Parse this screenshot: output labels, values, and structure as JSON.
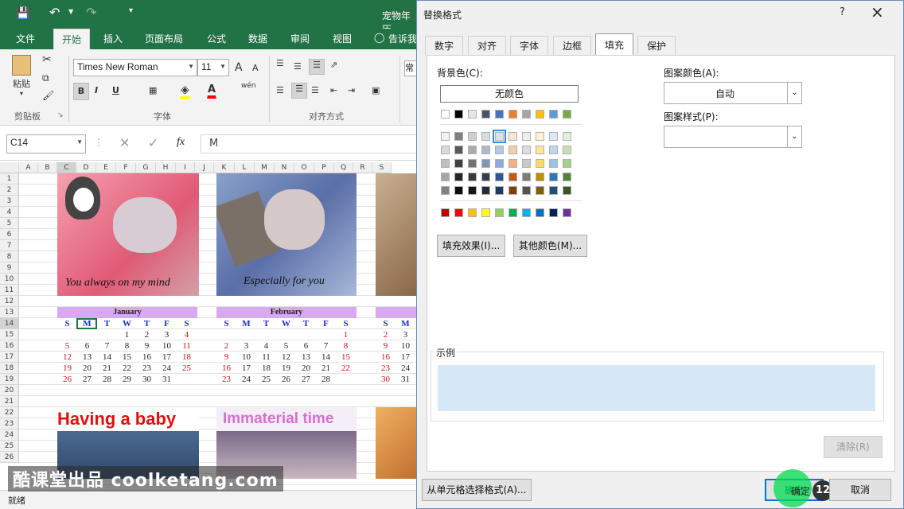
{
  "excel": {
    "doc_title": "宠物年历",
    "tabs": [
      "文件",
      "开始",
      "插入",
      "页面布局",
      "公式",
      "数据",
      "审阅",
      "视图"
    ],
    "tell_me": "告诉我",
    "clipboard": {
      "paste": "粘贴",
      "group": "剪贴板"
    },
    "font": {
      "name": "Times New Roman",
      "size": "11",
      "group": "字体",
      "grow": "A",
      "shrink": "A",
      "bold": "B",
      "italic": "I",
      "underline": "U",
      "wen": "wén"
    },
    "align": {
      "group": "对齐方式"
    },
    "style_peek": "常",
    "name_box": "C14",
    "fx": "fx",
    "formula_value": "M",
    "columns": [
      "A",
      "B",
      "C",
      "D",
      "E",
      "F",
      "G",
      "H",
      "I",
      "J",
      "K",
      "L",
      "M",
      "N",
      "O",
      "P",
      "Q",
      "R",
      "S"
    ],
    "rows": [
      "1",
      "2",
      "3",
      "4",
      "5",
      "6",
      "7",
      "8",
      "9",
      "10",
      "11",
      "12",
      "13",
      "14",
      "15",
      "16",
      "17",
      "18",
      "19",
      "20",
      "21",
      "22",
      "23",
      "24",
      "25",
      "26"
    ],
    "pictures": [
      "You always on my mind",
      "Especially for you",
      "Having a baby",
      "Immaterial time"
    ],
    "calendars": [
      {
        "month": "January",
        "days": [
          "S",
          "M",
          "T",
          "W",
          "T",
          "F",
          "S"
        ],
        "weeks": [
          [
            "",
            "",
            "",
            "",
            "1",
            "2",
            "3",
            "4"
          ],
          [
            "5",
            "6",
            "7",
            "8",
            "9",
            "10",
            "11"
          ],
          [
            "12",
            "13",
            "14",
            "15",
            "16",
            "17",
            "18"
          ],
          [
            "19",
            "20",
            "21",
            "22",
            "23",
            "24",
            "25"
          ],
          [
            "26",
            "27",
            "28",
            "29",
            "30",
            "31",
            ""
          ]
        ]
      },
      {
        "month": "February",
        "days": [
          "S",
          "M",
          "T",
          "W",
          "T",
          "F",
          "S"
        ],
        "weeks": [
          [
            "",
            "",
            "",
            "",
            "",
            "",
            "1"
          ],
          [
            "2",
            "3",
            "4",
            "5",
            "6",
            "7",
            "8"
          ],
          [
            "9",
            "10",
            "11",
            "12",
            "13",
            "14",
            "15"
          ],
          [
            "16",
            "17",
            "18",
            "19",
            "20",
            "21",
            "22"
          ],
          [
            "23",
            "24",
            "25",
            "26",
            "27",
            "28",
            ""
          ]
        ]
      }
    ],
    "cal3_days": [
      "S",
      "M"
    ],
    "cal3_nums": [
      [
        "",
        ""
      ],
      [
        "2",
        "3"
      ],
      [
        "9",
        "10"
      ],
      [
        "16",
        "17"
      ],
      [
        "23",
        "24"
      ],
      [
        "30",
        "31"
      ]
    ],
    "status": "就绪"
  },
  "dialog": {
    "title": "替换格式",
    "help": "?",
    "close": "×",
    "tabs": [
      "数字",
      "对齐",
      "字体",
      "边框",
      "填充",
      "保护"
    ],
    "active_tab": "填充",
    "bg_color_label": "背景色(C):",
    "no_color": "无颜色",
    "fill_effects": "填充效果(I)...",
    "more_colors": "其他颜色(M)...",
    "pattern_color_label": "图案颜色(A):",
    "pattern_color_value": "自动",
    "pattern_style_label": "图案样式(P):",
    "pattern_style_value": "",
    "sample_label": "示例",
    "sample_color": "#d7e8f7",
    "clear": "清除(R)",
    "from_cell": "从单元格选择格式(A)...",
    "ok": "确定",
    "cancel": "取消",
    "step_badge": "12",
    "theme_top": [
      "#ffffff",
      "#000000",
      "#e7e6e6",
      "#44546a",
      "#4472c4",
      "#ed7d31",
      "#a5a5a5",
      "#ffc000",
      "#5b9bd5",
      "#70ad47"
    ],
    "theme_shades": [
      [
        "#f2f2f2",
        "#7f7f7f",
        "#d0cece",
        "#d6dce4",
        "#d9e1f2",
        "#fce4d6",
        "#ededed",
        "#fff2cc",
        "#ddebf7",
        "#e2efda"
      ],
      [
        "#d9d9d9",
        "#595959",
        "#aeaaaa",
        "#acb9ca",
        "#b4c6e7",
        "#f8cbad",
        "#dbdbdb",
        "#ffe699",
        "#bdd7ee",
        "#c6e0b4"
      ],
      [
        "#bfbfbf",
        "#404040",
        "#757171",
        "#8497b0",
        "#8ea9db",
        "#f4b084",
        "#c9c9c9",
        "#ffd966",
        "#9bc2e6",
        "#a9d08e"
      ],
      [
        "#a6a6a6",
        "#262626",
        "#3a3838",
        "#333f4f",
        "#2f5597",
        "#c65911",
        "#7b7b7b",
        "#bf8f00",
        "#2e75b6",
        "#548235"
      ],
      [
        "#808080",
        "#0d0d0d",
        "#161616",
        "#222b35",
        "#1f3864",
        "#833c0c",
        "#525252",
        "#7f6000",
        "#1f4e78",
        "#375623"
      ]
    ],
    "standard": [
      "#c00000",
      "#ff0000",
      "#ffc000",
      "#ffff00",
      "#92d050",
      "#00b050",
      "#00b0f0",
      "#0070c0",
      "#002060",
      "#7030a0"
    ]
  },
  "watermark": "酷课堂出品 coolketang.com"
}
